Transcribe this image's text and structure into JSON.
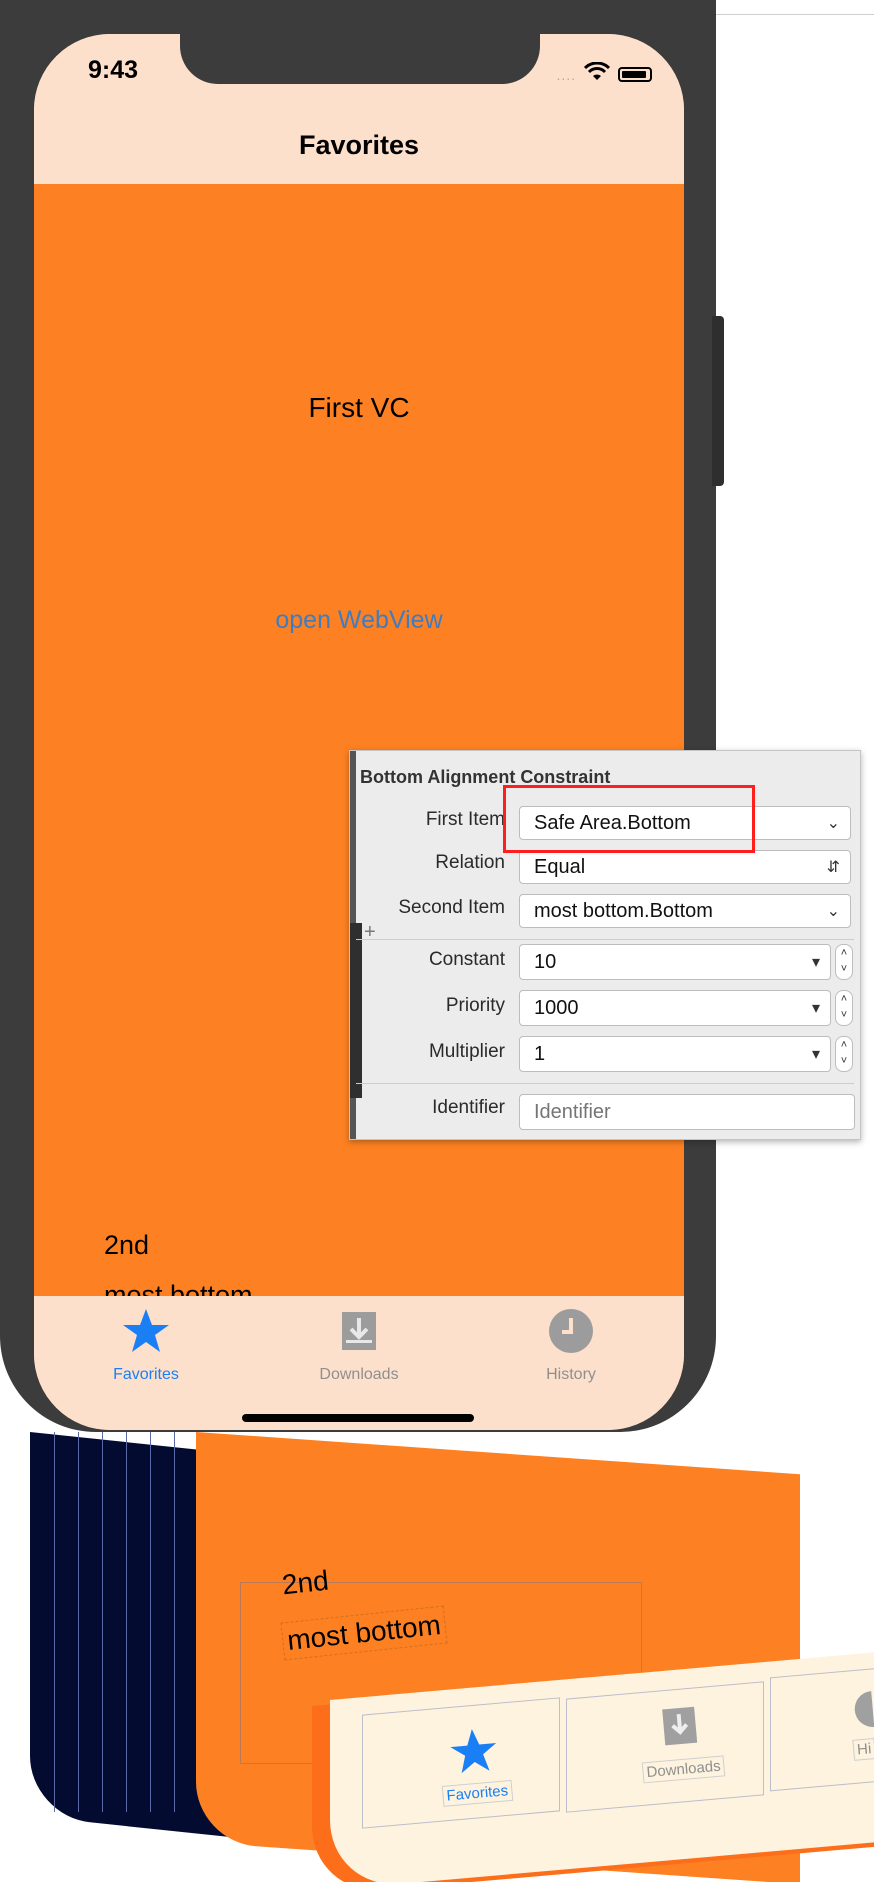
{
  "status": {
    "time": "9:43",
    "signal_dots": "....",
    "wifi_icon": "wifi-icon",
    "battery_icon": "battery-icon"
  },
  "nav": {
    "title": "Favorites"
  },
  "content": {
    "first_vc": "First VC",
    "open_webview": "open WebView",
    "second_label": "2nd",
    "most_bottom_label": "most bottom"
  },
  "tabbar": {
    "items": [
      {
        "label": "Favorites",
        "icon": "star-icon",
        "selected": true
      },
      {
        "label": "Downloads",
        "icon": "download-icon",
        "selected": false
      },
      {
        "label": "History",
        "icon": "clock-icon",
        "selected": false
      }
    ]
  },
  "colors": {
    "orange": "#fd8122",
    "tabbar_bg": "#fde0cc",
    "selected_tint": "#1a7ff5",
    "link": "#3f7cc0",
    "highlight": "#ff1e1e",
    "dark_layer": "#030c30"
  },
  "inspector": {
    "title": "Bottom Alignment Constraint",
    "first_item": {
      "label": "First Item",
      "value": "Safe Area.Bottom"
    },
    "relation": {
      "label": "Relation",
      "value": "Equal"
    },
    "second_item": {
      "label": "Second Item",
      "value": "most bottom.Bottom"
    },
    "constant": {
      "label": "Constant",
      "value": "10"
    },
    "priority": {
      "label": "Priority",
      "value": "1000"
    },
    "multiplier": {
      "label": "Multiplier",
      "value": "1"
    },
    "identifier": {
      "label": "Identifier",
      "placeholder": "Identifier"
    }
  },
  "debug_view": {
    "second_label": "2nd",
    "most_bottom_label": "most bottom",
    "tabs": [
      "Favorites",
      "Downloads",
      "Hi"
    ]
  }
}
